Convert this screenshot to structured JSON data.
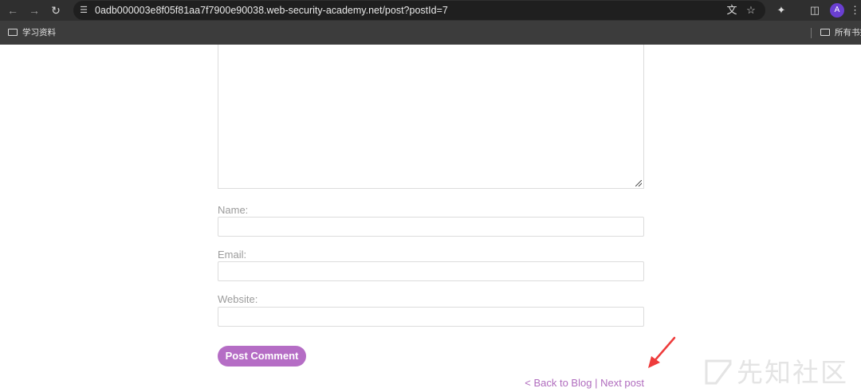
{
  "browser": {
    "url": "0adb000003e8f05f81aa7f7900e90038.web-security-academy.net/post?postId=7",
    "avatar_letter": "A",
    "bookmarks": {
      "left_folder": "学习资料",
      "right_folder": "所有书签"
    }
  },
  "form": {
    "name_label": "Name:",
    "email_label": "Email:",
    "website_label": "Website:",
    "submit_label": "Post Comment"
  },
  "footer_nav": {
    "back_label": "< Back to Blog",
    "separator": "|",
    "next_label": "Next post"
  },
  "watermark": {
    "text": "先知社区"
  },
  "colors": {
    "accent": "#b56dc5",
    "link": "#b06cbe",
    "annotation_arrow": "#ee3b3b",
    "chrome_bg": "#3c3c3c"
  }
}
